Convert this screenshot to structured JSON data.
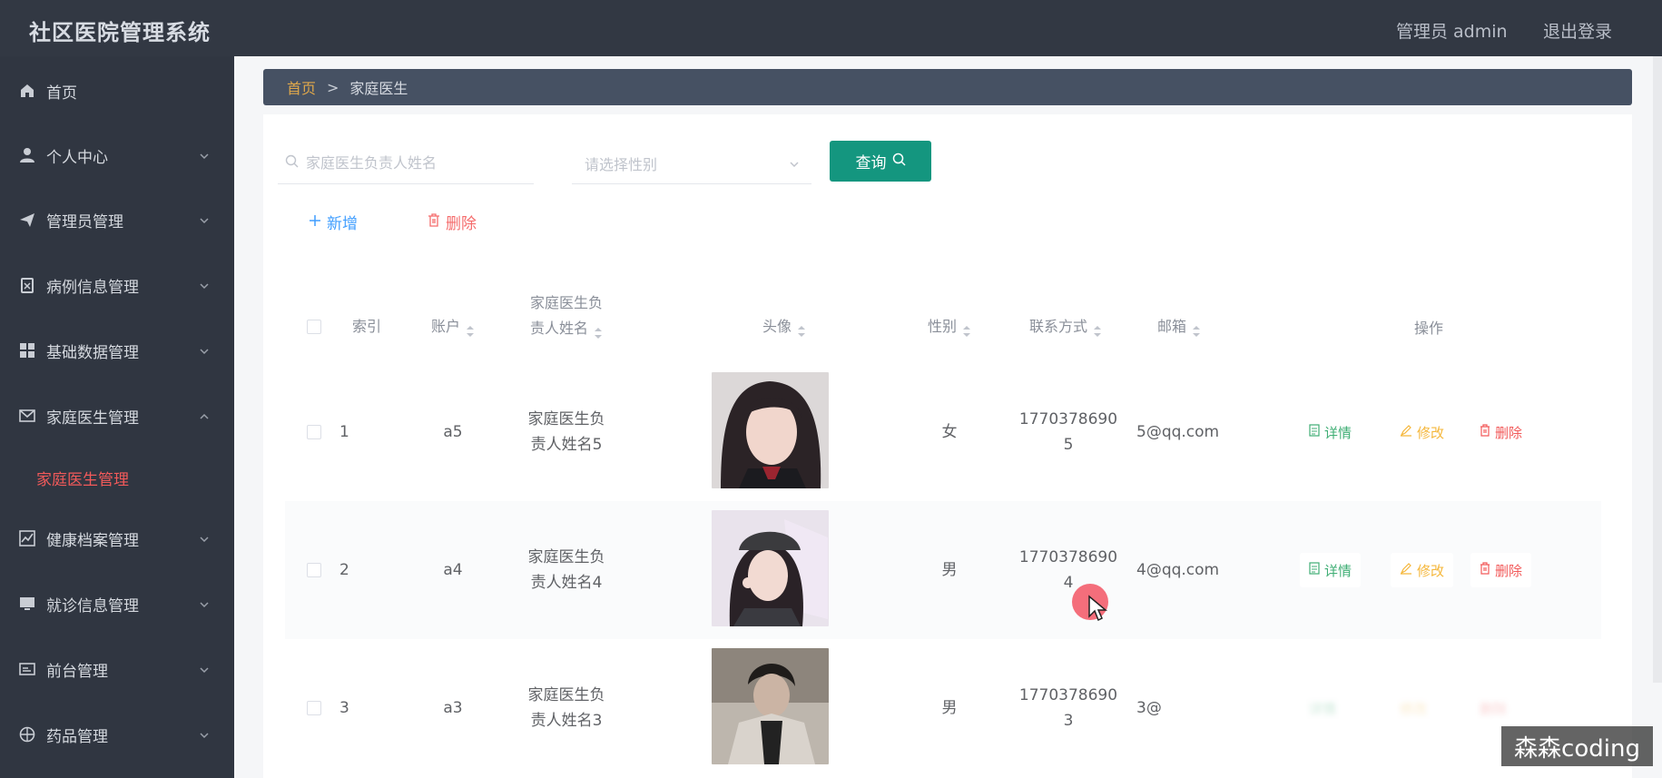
{
  "header": {
    "app_title": "社区医院管理系统",
    "user_label": "管理员 admin",
    "logout_label": "退出登录"
  },
  "sidebar": {
    "items": [
      {
        "label": "首页",
        "icon": "home-icon"
      },
      {
        "label": "个人中心",
        "icon": "user-icon"
      },
      {
        "label": "管理员管理",
        "icon": "paper-plane-icon"
      },
      {
        "label": "病例信息管理",
        "icon": "clipboard-icon"
      },
      {
        "label": "基础数据管理",
        "icon": "grid-icon"
      },
      {
        "label": "家庭医生管理",
        "icon": "mail-icon"
      },
      {
        "label": "健康档案管理",
        "icon": "chart-icon"
      },
      {
        "label": "就诊信息管理",
        "icon": "monitor-icon"
      },
      {
        "label": "前台管理",
        "icon": "card-icon"
      },
      {
        "label": "药品管理",
        "icon": "target-icon"
      }
    ],
    "active_submenu": "家庭医生管理"
  },
  "breadcrumb": {
    "home": "首页",
    "separator": ">",
    "current": "家庭医生"
  },
  "search": {
    "name_placeholder": "家庭医生负责人姓名",
    "gender_placeholder": "请选择性别",
    "query_label": "查询"
  },
  "actions": {
    "add_label": "新增",
    "delete_label": "删除"
  },
  "table": {
    "columns": {
      "index": "索引",
      "account": "账户",
      "name_line1": "家庭医生负",
      "name_line2": "责人姓名",
      "avatar": "头像",
      "gender": "性别",
      "phone": "联系方式",
      "email": "邮箱",
      "ops": "操作"
    },
    "rows": [
      {
        "index": "1",
        "account": "a5",
        "name_line1": "家庭医生负",
        "name_line2": "责人姓名5",
        "gender": "女",
        "phone_line1": "1770378690",
        "phone_line2": "5",
        "email": "5@qq.com"
      },
      {
        "index": "2",
        "account": "a4",
        "name_line1": "家庭医生负",
        "name_line2": "责人姓名4",
        "gender": "男",
        "phone_line1": "1770378690",
        "phone_line2": "4",
        "email": "4@qq.com"
      },
      {
        "index": "3",
        "account": "a3",
        "name_line1": "家庭医生负",
        "name_line2": "责人姓名3",
        "gender": "男",
        "phone_line1": "1770378690",
        "phone_line2": "3",
        "email": "3@"
      }
    ],
    "op_labels": {
      "detail": "详情",
      "edit": "修改",
      "delete": "删除"
    }
  },
  "watermark": "森森coding",
  "colors": {
    "topbar": "#323843",
    "sidebar": "#303641",
    "breadcrumb": "#465163",
    "primary_button": "#14967f",
    "active_menu": "#f25a5a",
    "add": "#409eff",
    "delete": "#f56c6c",
    "detail": "#3fae74",
    "edit": "#f5b73b"
  }
}
